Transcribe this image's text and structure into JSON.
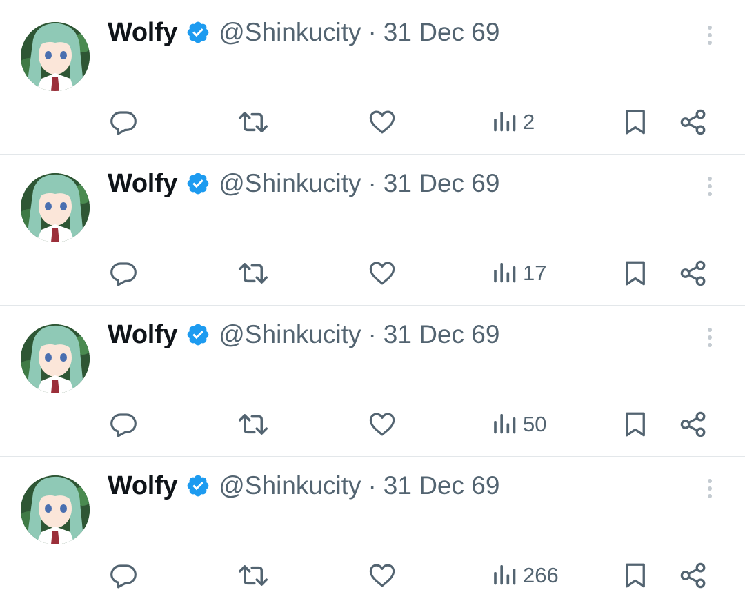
{
  "colors": {
    "name": "#0f1419",
    "secondary": "#536471",
    "verified": "#1d9bf0",
    "divider": "#e3e7ea"
  },
  "icons": {
    "reply": "speech-bubble-icon",
    "retweet": "retweet-arrows-icon",
    "like": "heart-icon",
    "views": "bar-chart-icon",
    "bookmark": "bookmark-icon",
    "share": "share-icon",
    "more": "vertical-dots-icon",
    "verified": "verified-badge-icon"
  },
  "tweets": [
    {
      "name": "Wolfy",
      "handle": "@Shinkucity",
      "separator": "·",
      "date": "31 Dec 69",
      "views": "2"
    },
    {
      "name": "Wolfy",
      "handle": "@Shinkucity",
      "separator": "·",
      "date": "31 Dec 69",
      "views": "17"
    },
    {
      "name": "Wolfy",
      "handle": "@Shinkucity",
      "separator": "·",
      "date": "31 Dec 69",
      "views": "50"
    },
    {
      "name": "Wolfy",
      "handle": "@Shinkucity",
      "separator": "·",
      "date": "31 Dec 69",
      "views": "266"
    }
  ]
}
